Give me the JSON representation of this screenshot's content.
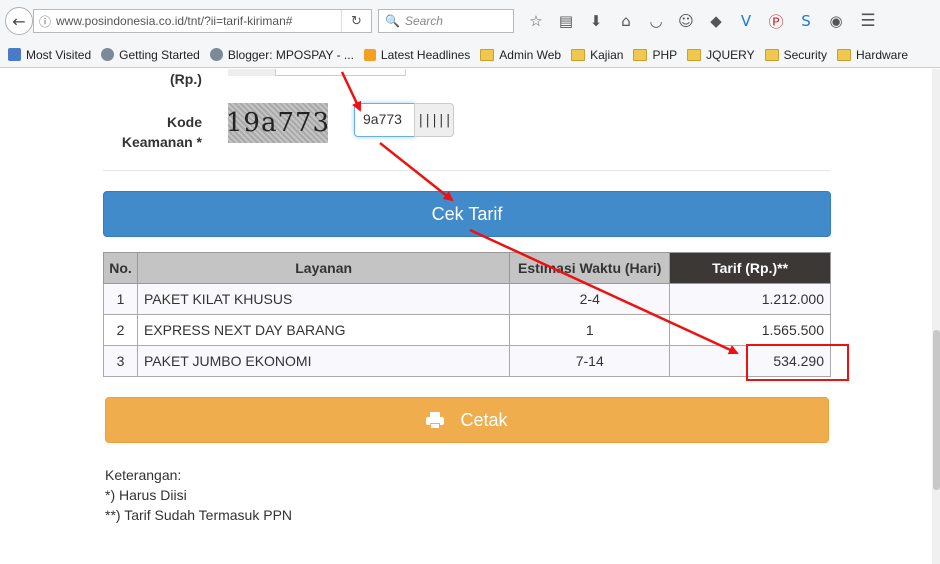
{
  "browser": {
    "url": "www.posindonesia.co.id/tnt/?ii=tarif-kiriman#",
    "search_placeholder": "Search",
    "back_glyph": "←",
    "info_glyph": "ⓘ",
    "reload_glyph": "↻",
    "search_glyph": "🔍"
  },
  "toolbar_icons": [
    {
      "name": "bookmark-star-icon",
      "glyph": "☆"
    },
    {
      "name": "reading-list-icon",
      "glyph": "▤"
    },
    {
      "name": "download-icon",
      "glyph": "⬇"
    },
    {
      "name": "home-icon",
      "glyph": "⌂"
    },
    {
      "name": "pocket-icon",
      "glyph": "◡"
    },
    {
      "name": "extension-smiley-icon",
      "glyph": "☺"
    },
    {
      "name": "extension-diamond-icon",
      "glyph": "◆"
    },
    {
      "name": "extension-v-icon",
      "glyph": "V"
    },
    {
      "name": "pinterest-icon",
      "glyph": "Ⓟ"
    },
    {
      "name": "extension-s-icon",
      "glyph": "S"
    },
    {
      "name": "extension-eye-icon",
      "glyph": "◉"
    },
    {
      "name": "menu-icon",
      "glyph": "☰"
    }
  ],
  "bookmarks": [
    {
      "name": "bookmark-most-visited",
      "label": "Most Visited",
      "icon": "mv"
    },
    {
      "name": "bookmark-getting-started",
      "label": "Getting Started",
      "icon": "globe"
    },
    {
      "name": "bookmark-blogger",
      "label": "Blogger: MPOSPAY - ...",
      "icon": "globe"
    },
    {
      "name": "bookmark-latest-headlines",
      "label": "Latest Headlines",
      "icon": "rss"
    },
    {
      "name": "bookmark-admin-web",
      "label": "Admin Web",
      "icon": "folder"
    },
    {
      "name": "bookmark-kajian",
      "label": "Kajian",
      "icon": "folder"
    },
    {
      "name": "bookmark-php",
      "label": "PHP",
      "icon": "folder"
    },
    {
      "name": "bookmark-jquery",
      "label": "JQUERY",
      "icon": "folder"
    },
    {
      "name": "bookmark-security",
      "label": "Security",
      "icon": "folder"
    },
    {
      "name": "bookmark-hardware",
      "label": "Hardware",
      "icon": "folder"
    }
  ],
  "form": {
    "rp_label": "(Rp.)",
    "kode_label_line1": "Kode",
    "kode_label_line2": "Keamanan *",
    "captcha_text": "19a773",
    "captcha_input_value": "9a773",
    "barcode_glyph": "|||||",
    "cek_button": "Cek Tarif"
  },
  "table": {
    "headers": [
      "No.",
      "Layanan",
      "Estimasi Waktu (Hari)",
      "Tarif (Rp.)**"
    ],
    "rows": [
      {
        "no": "1",
        "layanan": "PAKET KILAT KHUSUS",
        "estimasi": "2-4",
        "tarif": "1.212.000"
      },
      {
        "no": "2",
        "layanan": "EXPRESS NEXT DAY BARANG",
        "estimasi": "1",
        "tarif": "1.565.500"
      },
      {
        "no": "3",
        "layanan": "PAKET JUMBO EKONOMI",
        "estimasi": "7-14",
        "tarif": "534.290"
      }
    ]
  },
  "cetak_button": "Cetak",
  "notes": {
    "title": "Keterangan:",
    "line1": "*) Harus Diisi",
    "line2": "**) Tarif Sudah Termasuk PPN"
  },
  "colors": {
    "primary": "#428bca",
    "warning": "#f0ad4e",
    "annotation_red": "#e11111",
    "header_dark": "#3b3835"
  }
}
